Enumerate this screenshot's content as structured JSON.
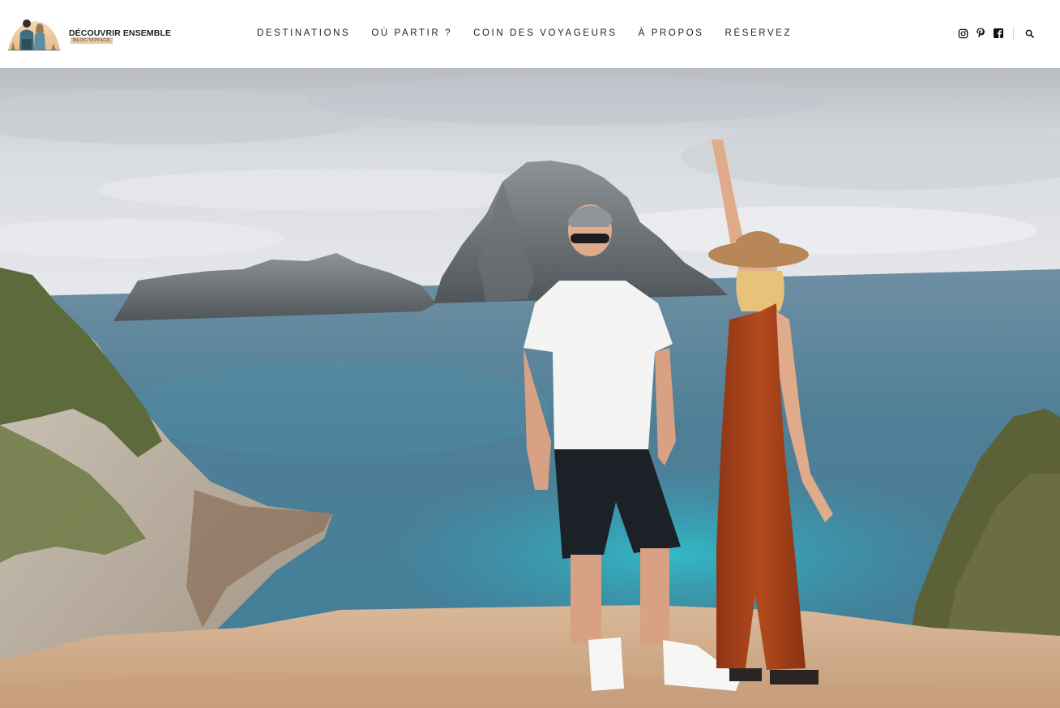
{
  "site": {
    "logo_title": "DÉCOUVRIR ENSEMBLE",
    "logo_subtitle": "BLOG VOYAGE"
  },
  "nav": {
    "items": [
      {
        "label": "DESTINATIONS"
      },
      {
        "label": "OÙ PARTIR ?"
      },
      {
        "label": "COIN DES VOYAGEURS"
      },
      {
        "label": "À PROPOS"
      },
      {
        "label": "RÉSERVEZ"
      }
    ]
  },
  "header_icons": [
    "instagram-icon",
    "pinterest-icon",
    "facebook-icon",
    "search-icon"
  ],
  "colors": {
    "text": "#222222",
    "header_bg": "#ffffff",
    "sea": "#3f7f98",
    "lagoon": "#2fb2c2",
    "sky": "#dcdfe4",
    "dress": "#a8431c",
    "hat": "#b88758"
  },
  "hero": {
    "image_subject": "hero-photo-couple-ibiza-coast"
  }
}
